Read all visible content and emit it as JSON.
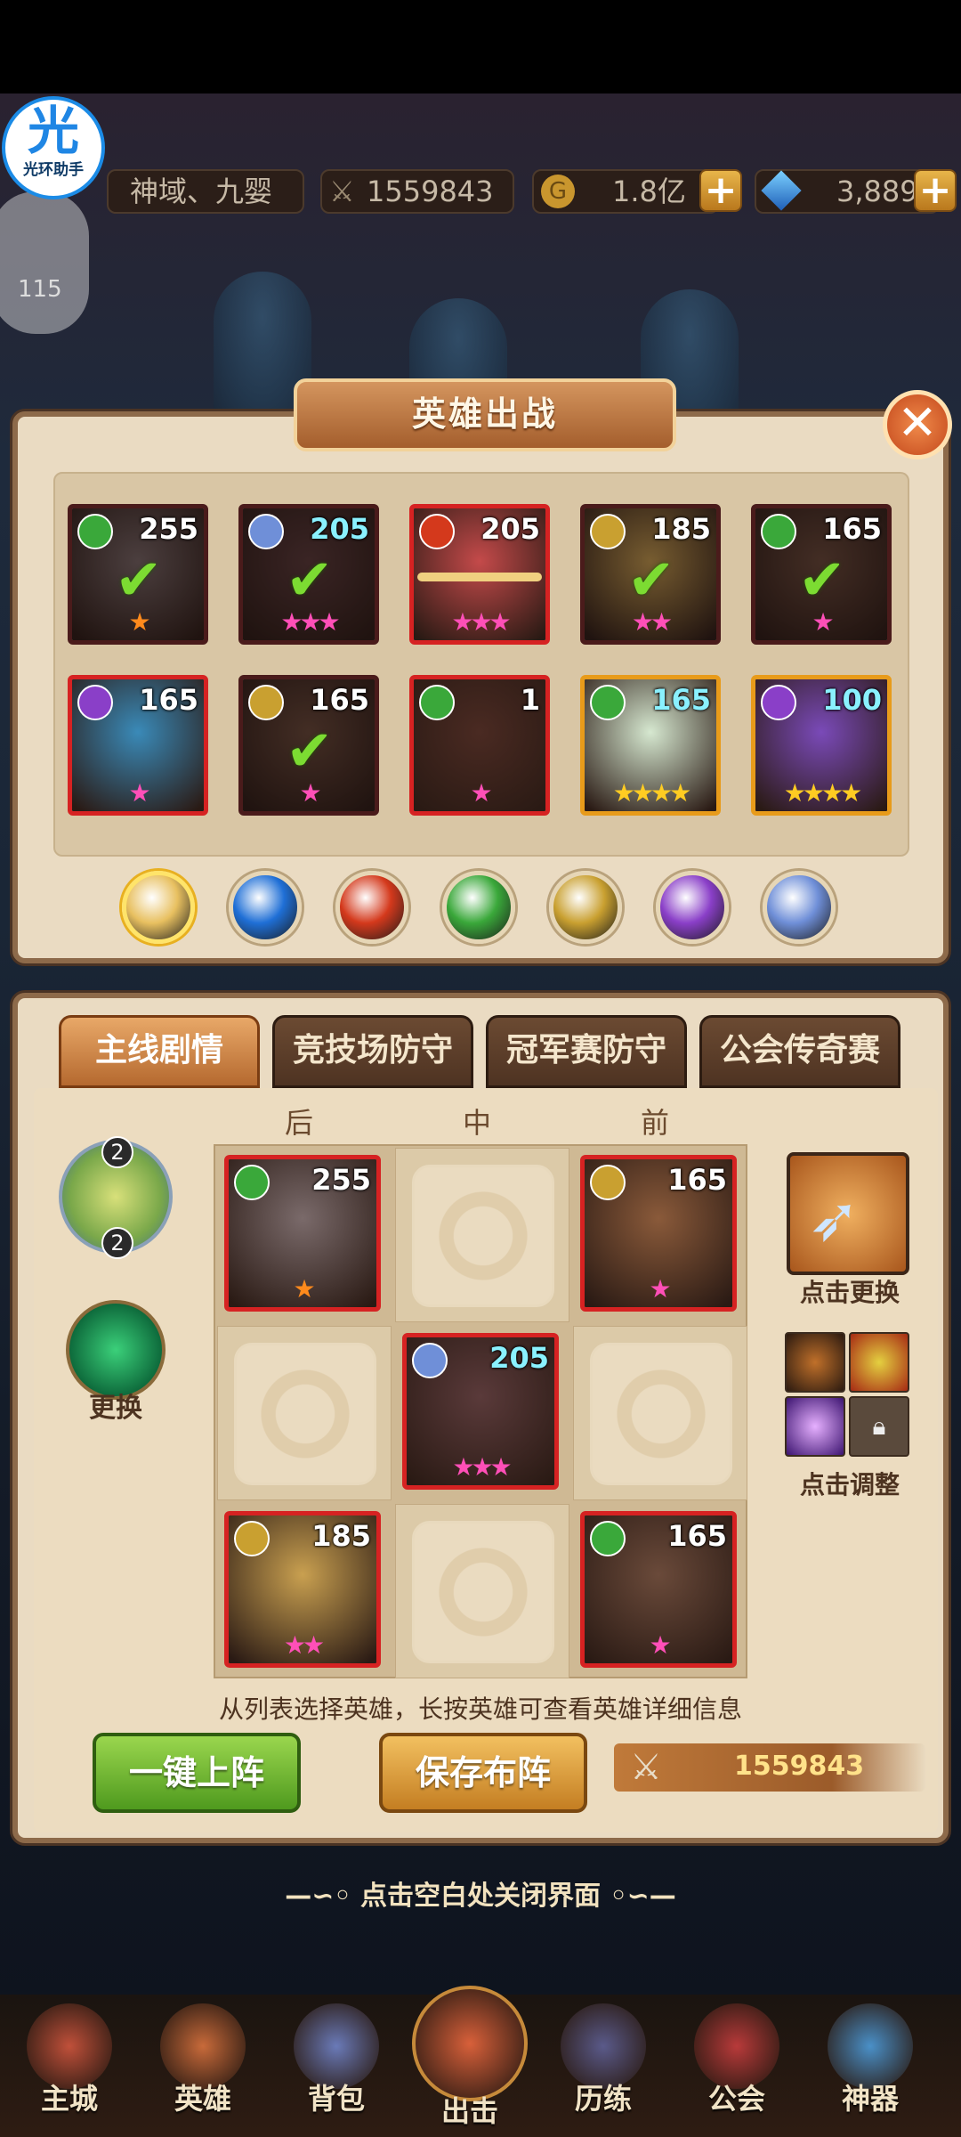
{
  "app_badge": {
    "icon_char": "光",
    "label": "光环助手"
  },
  "topbar": {
    "server": "神域、九婴",
    "power": "1559843",
    "gold": "1.8亿",
    "gems": "3,889",
    "level_badge": "115"
  },
  "hero_select": {
    "title": "英雄出战",
    "close_symbol": "✕",
    "heroes": [
      {
        "level": "255",
        "element": "wind",
        "stars": 1,
        "star_color": "orange",
        "deployed": true
      },
      {
        "level": "205",
        "element": "light",
        "stars": 3,
        "star_color": "pink",
        "deployed": true
      },
      {
        "level": "205",
        "element": "fire",
        "stars": 3,
        "star_color": "pink",
        "deployed": false,
        "locked": true
      },
      {
        "level": "185",
        "element": "sun",
        "stars": 2,
        "star_color": "pink",
        "deployed": true
      },
      {
        "level": "165",
        "element": "wind",
        "stars": 1,
        "star_color": "pink",
        "deployed": true
      },
      {
        "level": "165",
        "element": "dark",
        "stars": 1,
        "star_color": "pink",
        "deployed": false
      },
      {
        "level": "165",
        "element": "sun",
        "stars": 1,
        "star_color": "pink",
        "deployed": true
      },
      {
        "level": "1",
        "element": "wind",
        "stars": 1,
        "star_color": "pink",
        "deployed": false
      },
      {
        "level": "165",
        "element": "wind",
        "stars": 4,
        "star_color": "gold",
        "deployed": false
      },
      {
        "level": "100",
        "element": "dark",
        "stars": 4,
        "star_color": "gold",
        "deployed": false
      }
    ],
    "element_filters": [
      "all",
      "water",
      "fire",
      "wind",
      "sun",
      "dark",
      "light"
    ]
  },
  "formation": {
    "tabs": [
      "主线剧情",
      "竞技场防守",
      "冠军赛防守",
      "公会传奇赛"
    ],
    "active_tab": 0,
    "columns": [
      "后",
      "中",
      "前"
    ],
    "left_panel": {
      "badge_top": "2",
      "badge_bottom": "2",
      "swap_label": "更换"
    },
    "grid": [
      {
        "level": "255",
        "element": "wind",
        "stars": 1
      },
      null,
      {
        "level": "165",
        "element": "sun",
        "stars": 1
      },
      null,
      {
        "level": "205",
        "element": "light",
        "stars": 3
      },
      null,
      {
        "level": "185",
        "element": "sun",
        "stars": 2
      },
      null,
      {
        "level": "165",
        "element": "wind",
        "stars": 1
      }
    ],
    "artifact_label": "点击更换",
    "skills_label": "点击调整",
    "hint": "从列表选择英雄，长按英雄可查看英雄详细信息",
    "auto_button": "一键上阵",
    "save_button": "保存布阵",
    "total_power": "1559843"
  },
  "close_hint": "点击空白处关闭界面",
  "nav": [
    "主城",
    "英雄",
    "背包",
    "出击",
    "历练",
    "公会",
    "神器"
  ],
  "colors": {
    "wind": "#3aa83a",
    "water": "#1f6fd6",
    "fire": "#d4391c",
    "sun": "#c9a030",
    "dark": "#8a3fc8",
    "light": "#6f8fd8"
  }
}
